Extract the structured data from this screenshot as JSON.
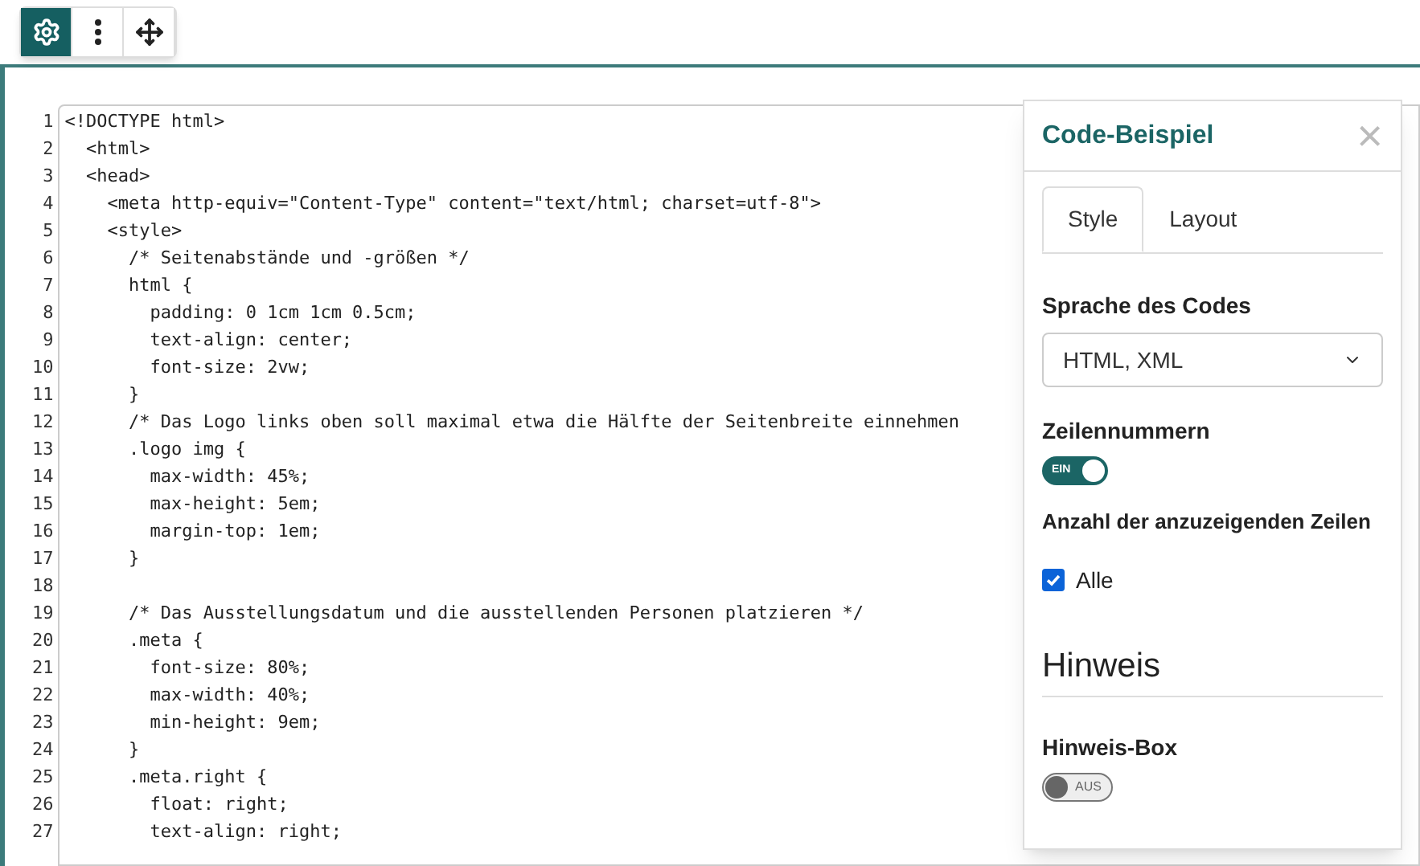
{
  "toolbar": {
    "buttons": [
      {
        "kind": "gear",
        "selected": true
      },
      {
        "kind": "dots",
        "selected": false
      },
      {
        "kind": "move",
        "selected": false
      }
    ]
  },
  "code": {
    "lines": [
      {
        "number": "1",
        "text": "<!DOCTYPE html>"
      },
      {
        "number": "2",
        "text": "  <html>"
      },
      {
        "number": "3",
        "text": "  <head>"
      },
      {
        "number": "4",
        "text": "    <meta http-equiv=\"Content-Type\" content=\"text/html; charset=utf-8\">"
      },
      {
        "number": "5",
        "text": "    <style>"
      },
      {
        "number": "6",
        "text": "      /* Seitenabstände und -größen */"
      },
      {
        "number": "7",
        "text": "      html {"
      },
      {
        "number": "8",
        "text": "        padding: 0 1cm 1cm 0.5cm;"
      },
      {
        "number": "9",
        "text": "        text-align: center;"
      },
      {
        "number": "10",
        "text": "        font-size: 2vw;"
      },
      {
        "number": "11",
        "text": "      }"
      },
      {
        "number": "12",
        "text": "      /* Das Logo links oben soll maximal etwa die Hälfte der Seitenbreite einnehmen"
      },
      {
        "number": "13",
        "text": "      .logo img {"
      },
      {
        "number": "14",
        "text": "        max-width: 45%;"
      },
      {
        "number": "15",
        "text": "        max-height: 5em;"
      },
      {
        "number": "16",
        "text": "        margin-top: 1em;"
      },
      {
        "number": "17",
        "text": "      }"
      },
      {
        "number": "18"
      },
      {
        "number": "19",
        "text": "      /* Das Ausstellungsdatum und die ausstellenden Personen platzieren */"
      },
      {
        "number": "20",
        "text": "      .meta {"
      },
      {
        "number": "21",
        "text": "        font-size: 80%;"
      },
      {
        "number": "22",
        "text": "        max-width: 40%;"
      },
      {
        "number": "23",
        "text": "        min-height: 9em;"
      },
      {
        "number": "24",
        "text": "      }"
      },
      {
        "number": "25",
        "text": "      .meta.right {"
      },
      {
        "number": "26",
        "text": "        float: right;"
      },
      {
        "number": "27",
        "text": "        text-align: right;"
      }
    ]
  },
  "panel": {
    "title": "Code-Beispiel",
    "close": "×",
    "tabs": [
      {
        "label": "Style",
        "selected": true
      },
      {
        "label": "Layout",
        "selected": false
      }
    ],
    "language": {
      "label": "Sprache des Codes",
      "value": "HTML, XML"
    },
    "line_numbers": {
      "label": "Zeilennummern",
      "on": true,
      "state_text": "EIN"
    },
    "rows_count": {
      "label": "Anzahl der anzuzeigenden Zeilen",
      "option": "Alle",
      "checked": true
    },
    "section": "Hinweis",
    "hint_box": {
      "label": "Hinweis-Box",
      "on": false,
      "state_text": "AUS"
    }
  }
}
